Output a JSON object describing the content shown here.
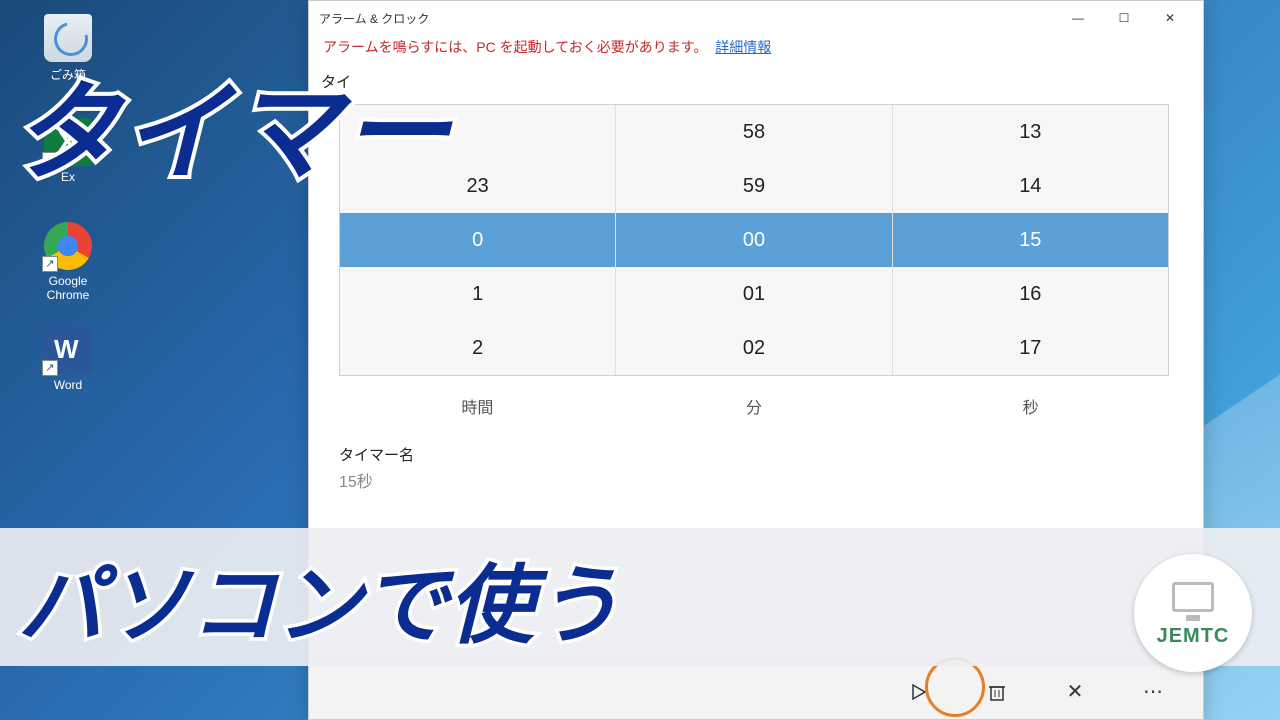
{
  "desktop": {
    "recycle_label": "ごみ箱",
    "excel_label": "Ex",
    "chrome_label": "Google Chrome",
    "word_label": "Word"
  },
  "window": {
    "title": "アラーム & クロック",
    "notice_text": "アラームを鳴らすには、PC を起動しておく必要があります。",
    "notice_link": "詳細情報",
    "section_label": "タイ",
    "picker": {
      "hours": [
        "",
        "23",
        "0",
        "1",
        "2"
      ],
      "minutes": [
        "58",
        "59",
        "00",
        "01",
        "02"
      ],
      "seconds": [
        "13",
        "14",
        "15",
        "16",
        "17"
      ],
      "label_hour": "時間",
      "label_min": "分",
      "label_sec": "秒"
    },
    "timer_name_label": "タイマー名",
    "timer_name_value": "15秒"
  },
  "overlay": {
    "title": "タイマー",
    "subtitle": "パソコンで使う",
    "logo_text": "JEMTC"
  }
}
